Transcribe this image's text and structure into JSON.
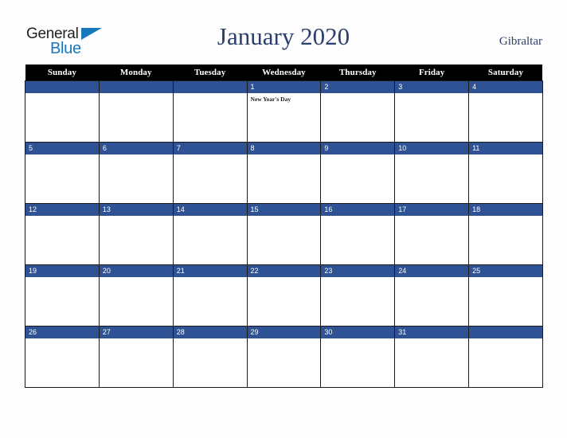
{
  "brand": {
    "name_part1": "General",
    "name_part2": "Blue",
    "triangle_icon": "triangle-icon",
    "accent_color": "#1878be",
    "text_color": "#231f20"
  },
  "header": {
    "title": "January 2020",
    "country": "Gibraltar",
    "title_color": "#2b3f6c"
  },
  "calendar": {
    "month": "January",
    "year": "2020",
    "accent_color": "#2e5293",
    "header_bg": "#000000",
    "weekdays": [
      "Sunday",
      "Monday",
      "Tuesday",
      "Wednesday",
      "Thursday",
      "Friday",
      "Saturday"
    ],
    "weeks": [
      [
        {
          "day": "",
          "events": []
        },
        {
          "day": "",
          "events": []
        },
        {
          "day": "",
          "events": []
        },
        {
          "day": "1",
          "events": [
            "New Year's Day"
          ]
        },
        {
          "day": "2",
          "events": []
        },
        {
          "day": "3",
          "events": []
        },
        {
          "day": "4",
          "events": []
        }
      ],
      [
        {
          "day": "5",
          "events": []
        },
        {
          "day": "6",
          "events": []
        },
        {
          "day": "7",
          "events": []
        },
        {
          "day": "8",
          "events": []
        },
        {
          "day": "9",
          "events": []
        },
        {
          "day": "10",
          "events": []
        },
        {
          "day": "11",
          "events": []
        }
      ],
      [
        {
          "day": "12",
          "events": []
        },
        {
          "day": "13",
          "events": []
        },
        {
          "day": "14",
          "events": []
        },
        {
          "day": "15",
          "events": []
        },
        {
          "day": "16",
          "events": []
        },
        {
          "day": "17",
          "events": []
        },
        {
          "day": "18",
          "events": []
        }
      ],
      [
        {
          "day": "19",
          "events": []
        },
        {
          "day": "20",
          "events": []
        },
        {
          "day": "21",
          "events": []
        },
        {
          "day": "22",
          "events": []
        },
        {
          "day": "23",
          "events": []
        },
        {
          "day": "24",
          "events": []
        },
        {
          "day": "25",
          "events": []
        }
      ],
      [
        {
          "day": "26",
          "events": []
        },
        {
          "day": "27",
          "events": []
        },
        {
          "day": "28",
          "events": []
        },
        {
          "day": "29",
          "events": []
        },
        {
          "day": "30",
          "events": []
        },
        {
          "day": "31",
          "events": []
        },
        {
          "day": "",
          "events": []
        }
      ]
    ]
  }
}
